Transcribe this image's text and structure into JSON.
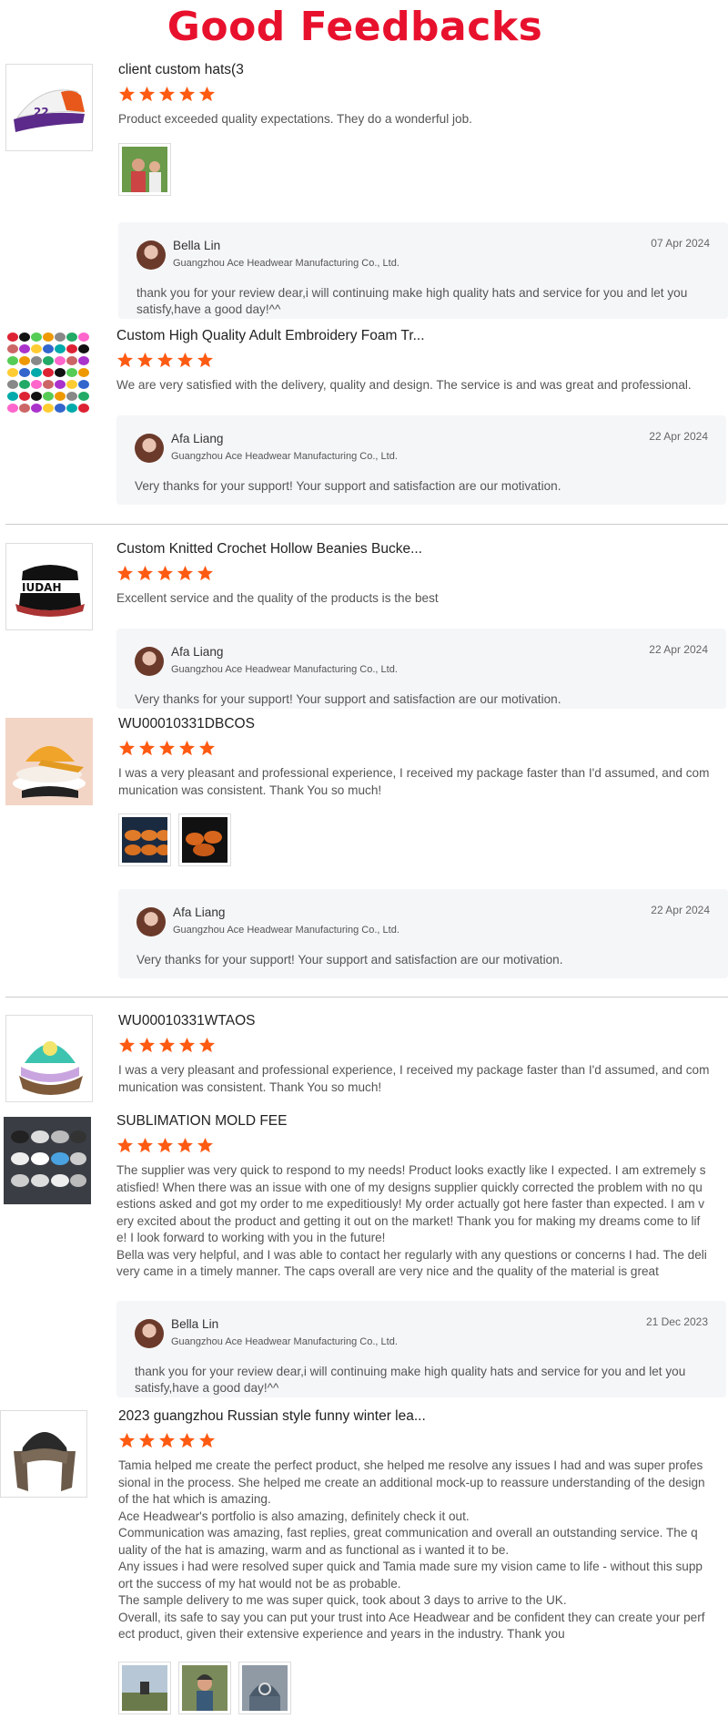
{
  "header": {
    "title": "Good Feedbacks"
  },
  "colors": {
    "title": "#e8112d",
    "star": "#ff5a12",
    "reply_bg": "#f5f6f8"
  },
  "icons": {
    "rating": "star-icon"
  },
  "reviews": [
    {
      "title": "client custom hats(3",
      "rating": 5,
      "text": [
        "Product exceeded quality expectations. They do a wonderful job."
      ],
      "photo_count": 1,
      "reply": {
        "name": "Bella Lin",
        "company": "Guangzhou Ace Headwear Manufacturing Co., Ltd.",
        "date": "07 Apr 2024",
        "text": [
          "thank you for your review dear,i will continuing make high quality hats and service for you and let you",
          "satisfy,have a good day!^^"
        ]
      }
    },
    {
      "title": "Custom High Quality Adult Embroidery Foam Tr...",
      "rating": 5,
      "text": [
        "We are very satisfied with the delivery, quality and design. The service is and was great and professional."
      ],
      "photo_count": 0,
      "reply": {
        "name": "Afa Liang",
        "company": "Guangzhou Ace Headwear Manufacturing Co., Ltd.",
        "date": "22 Apr 2024",
        "text": [
          "Very thanks for your support! Your support and satisfaction are our motivation."
        ]
      }
    },
    {
      "title": "Custom Knitted Crochet Hollow Beanies Bucke...",
      "rating": 5,
      "text": [
        "Excellent service and the quality of the products is the best"
      ],
      "photo_count": 0,
      "reply": {
        "name": "Afa Liang",
        "company": "Guangzhou Ace Headwear Manufacturing Co., Ltd.",
        "date": "22 Apr 2024",
        "text": [
          "Very thanks for your support! Your support and satisfaction are our motivation."
        ]
      }
    },
    {
      "title": "WU00010331DBCOS",
      "rating": 5,
      "text": [
        "I was a very pleasant and professional experience, I received my package faster than I'd assumed, and com",
        "munication was consistent. Thank You so much!"
      ],
      "photo_count": 2,
      "reply": {
        "name": "Afa Liang",
        "company": "Guangzhou Ace Headwear Manufacturing Co., Ltd.",
        "date": "22 Apr 2024",
        "text": [
          "Very thanks for your support! Your support and satisfaction are our motivation."
        ]
      }
    },
    {
      "title": "WU00010331WTAOS",
      "rating": 5,
      "text": [
        "I was a very pleasant and professional experience, I received my package faster than I'd assumed, and com",
        "munication was consistent. Thank You so much!"
      ],
      "photo_count": 0,
      "reply": null
    },
    {
      "title": "SUBLIMATION MOLD FEE",
      "rating": 5,
      "text": [
        "The supplier was very quick to respond to my needs! Product looks exactly like I expected. I am extremely s",
        "atisfied! When there was an issue with one of my designs supplier quickly corrected the problem with no qu",
        "estions asked and got my order to me expeditiously! My order actually got here faster than expected. I am v",
        "ery excited about the product and getting it out on the market! Thank you for making my dreams come to lif",
        "e! I look forward to working with you in the future!",
        "Bella was very helpful, and I was able to contact her regularly with any questions or concerns I had. The deli",
        "very came in a timely manner. The caps overall are very nice and the quality of the material is great"
      ],
      "photo_count": 0,
      "reply": {
        "name": "Bella Lin",
        "company": "Guangzhou Ace Headwear Manufacturing Co., Ltd.",
        "date": "21 Dec 2023",
        "text": [
          "thank you for your review dear,i will continuing make high quality hats and service for you and let you",
          "satisfy,have a good day!^^"
        ]
      }
    },
    {
      "title": "2023 guangzhou Russian style funny winter lea...",
      "rating": 5,
      "text": [
        "Tamia helped me create the perfect product, she helped me resolve any issues I had and was super profes",
        "sional in the process. She helped me create an additional mock-up to reassure understanding of the design",
        "of the hat which is amazing.",
        "Ace Headwear's portfolio is also amazing, definitely check it out.",
        "Communication was amazing, fast replies, great communication and overall an outstanding service. The q",
        "uality of the hat is amazing, warm and as functional as i wanted it to be.",
        "Any issues i had were resolved super quick and Tamia made sure my vision came to life - without this supp",
        "ort the success of my hat would not be as probable.",
        "The sample delivery to me was super quick, took about 3 days to arrive to the UK.",
        "Overall, its safe to say you can put your trust into Ace Headwear and be confident they can create your perf",
        "ect product, given their extensive experience and years in the industry. Thank you"
      ],
      "photo_count": 3,
      "reply": null
    }
  ]
}
